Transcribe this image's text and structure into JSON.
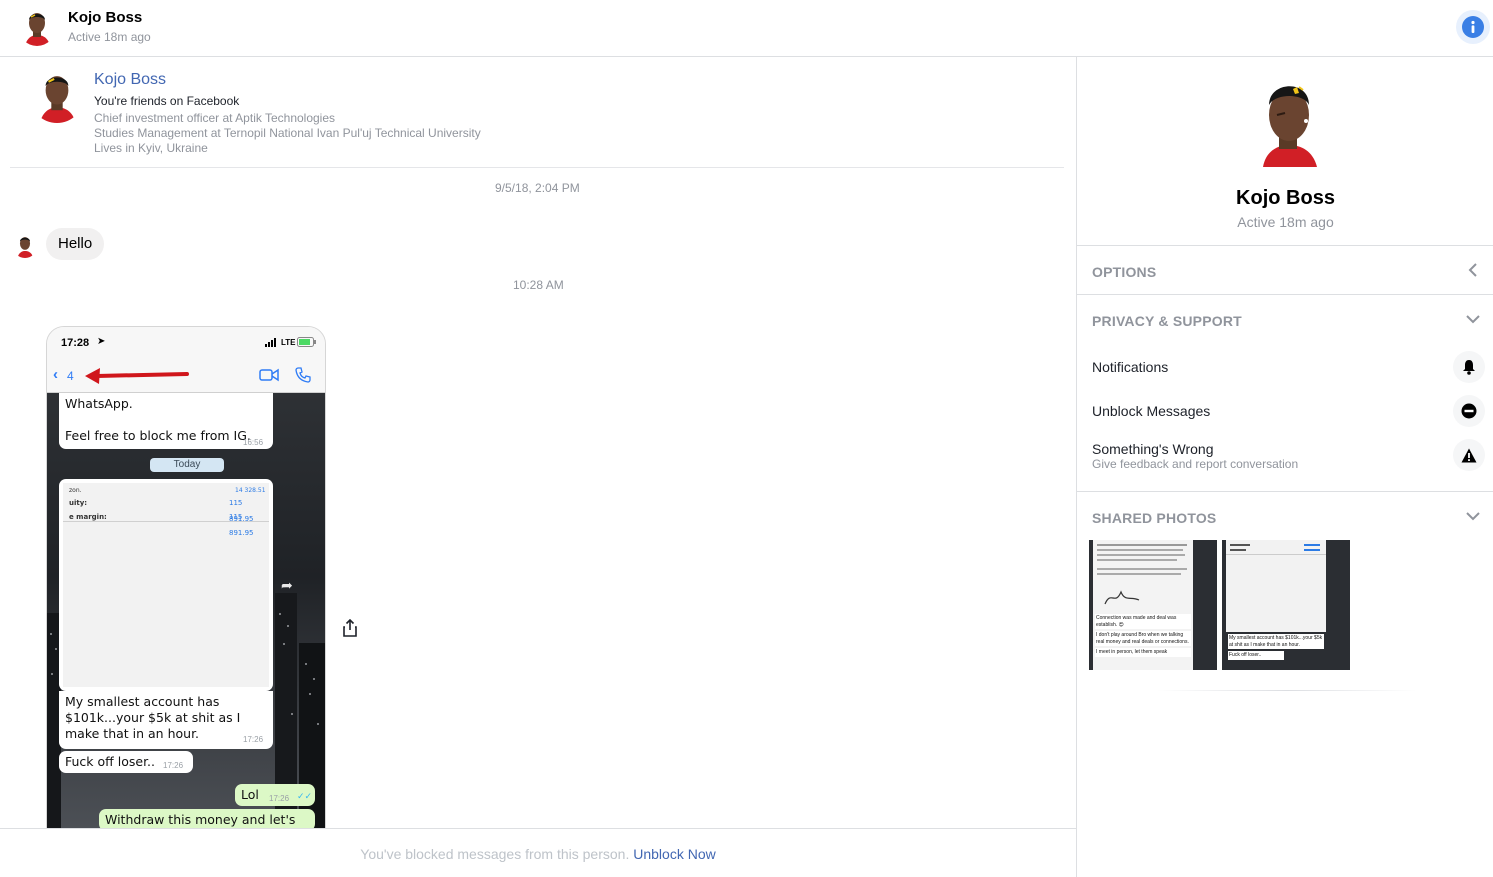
{
  "header": {
    "name": "Kojo Boss",
    "status": "Active 18m ago"
  },
  "intro": {
    "name": "Kojo Boss",
    "friends": "You're friends on Facebook",
    "job": "Chief investment officer at Aptik Technologies",
    "education": "Studies Management at Ternopil National Ivan Pul'uj Technical University",
    "location": "Lives in Kyiv, Ukraine"
  },
  "messages": {
    "timestamp_1": "9/5/18, 2:04 PM",
    "hello": "Hello",
    "timestamp_2": "10:28 AM"
  },
  "screenshot": {
    "time": "17:28",
    "network": "LTE",
    "back_count": "4",
    "msg_whatsapp": "WhatsApp.",
    "msg_block": "Feel free to block me from IG.",
    "msg_block_time": "16:56",
    "today": "Today",
    "row_equity": "uity:",
    "row_equity_val": "115 891.95",
    "row_margin": "e margin:",
    "row_margin_val": "115 891.95",
    "row_top_val": "14 328.51",
    "msg_smallest": "My smallest account has $101k...your $5k at shit as I make that in an hour.",
    "msg_smallest_time": "17:26",
    "msg_loser": "Fuck off loser..",
    "msg_loser_time": "17:26",
    "msg_lol": "Lol",
    "msg_lol_time": "17:26",
    "msg_withdraw": "Withdraw this money and let's see"
  },
  "footer": {
    "blocked_text": "You've blocked messages from this person.",
    "unblock_link": "Unblock Now"
  },
  "panel": {
    "name": "Kojo Boss",
    "status": "Active 18m ago",
    "options_title": "OPTIONS",
    "privacy_title": "PRIVACY & SUPPORT",
    "notifications": "Notifications",
    "unblock": "Unblock Messages",
    "wrong": "Something's Wrong",
    "wrong_sub": "Give feedback and report conversation",
    "shared_title": "SHARED PHOTOS",
    "thumb1_lines": [
      "Connection was made and deal was establish. 😍",
      "I don't play around Bro when we talking real money and real deals or connections.",
      "I meet in person, let them speak"
    ],
    "thumb2_lines": [
      "My smallest account has $101k...your $5k at shit as I make that in an hour.",
      "Fuck off loser.."
    ]
  },
  "colors": {
    "accent": "#4267b2",
    "info_blue": "#3a7fe5",
    "muted": "#90949c",
    "bubble_gray": "#f1f0f0",
    "whatsapp_green": "#dcf8c6"
  }
}
